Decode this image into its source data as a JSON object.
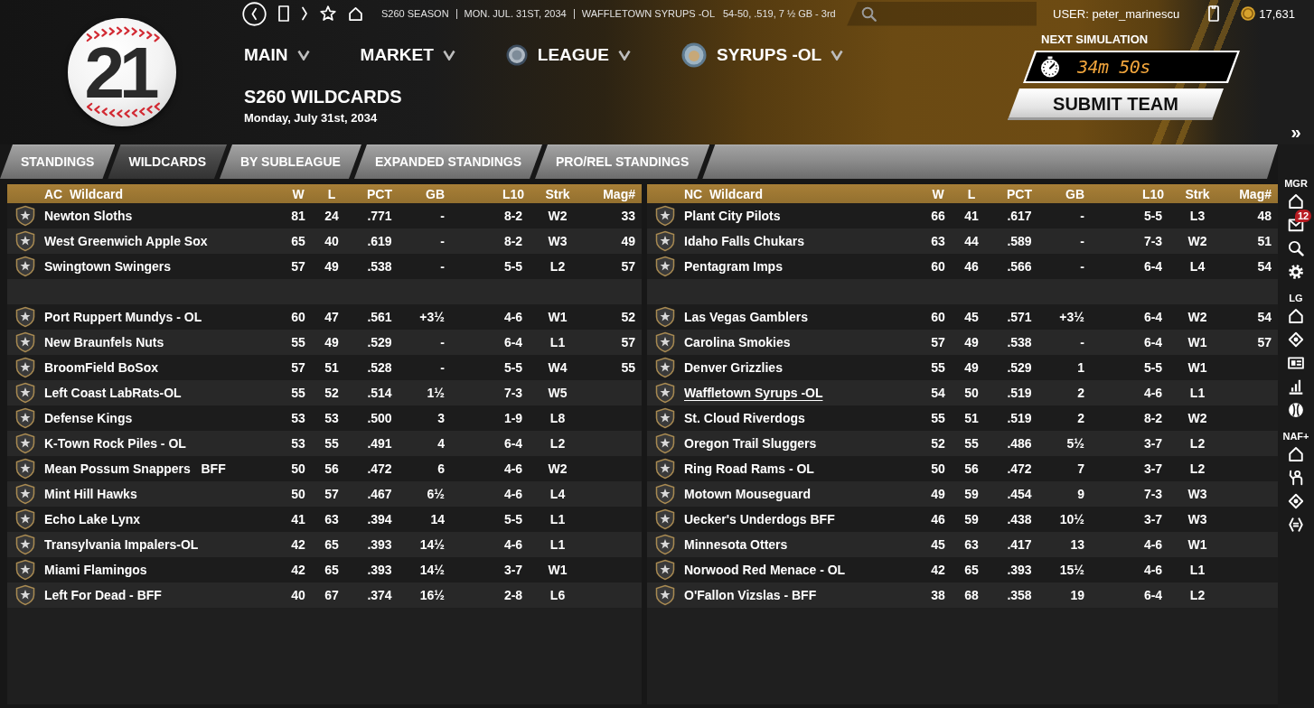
{
  "top_bar": {
    "season": "S260 SEASON",
    "date": "MON. JUL. 31ST, 2034",
    "team": "WAFFLETOWN SYRUPS -OL",
    "record": "54-50, .519, 7 ½ GB - 3rd",
    "user": "USER: peter_marinescu",
    "coins": "17,631"
  },
  "logo": {
    "text": "21"
  },
  "menu": [
    {
      "label": "MAIN",
      "kind": "plain"
    },
    {
      "label": "MARKET",
      "kind": "plain"
    },
    {
      "label": "LEAGUE",
      "kind": "league"
    },
    {
      "label": "SYRUPS -OL",
      "kind": "team"
    }
  ],
  "page": {
    "title": "S260 WILDCARDS",
    "subtitle": "Monday, July 31st, 2034"
  },
  "simulation": {
    "label": "NEXT SIMULATION",
    "countdown": "34m 50s",
    "button": "SUBMIT TEAM"
  },
  "expand": "»",
  "tabs": [
    {
      "label": "STANDINGS",
      "selected": false
    },
    {
      "label": "WILDCARDS",
      "selected": true
    },
    {
      "label": "BY SUBLEAGUE",
      "selected": false
    },
    {
      "label": "EXPANDED STANDINGS",
      "selected": false
    },
    {
      "label": "PRO/REL STANDINGS",
      "selected": false
    }
  ],
  "tables": [
    {
      "title": "AC  Wildcard",
      "columns": [
        "W",
        "L",
        "PCT",
        "GB",
        "L10",
        "Strk",
        "Mag#"
      ],
      "groups": [
        {
          "rows": [
            {
              "team": "Newton Sloths",
              "stats": [
                "81",
                "24",
                ".771",
                "-",
                "8-2",
                "W2",
                "33"
              ],
              "user_team": false
            },
            {
              "team": "West Greenwich Apple Sox",
              "stats": [
                "65",
                "40",
                ".619",
                "-",
                "8-2",
                "W3",
                "49"
              ],
              "user_team": false
            },
            {
              "team": "Swingtown Swingers",
              "stats": [
                "57",
                "49",
                ".538",
                "-",
                "5-5",
                "L2",
                "57"
              ],
              "user_team": false
            }
          ]
        },
        {
          "rows": [
            {
              "team": "Port Ruppert Mundys - OL",
              "stats": [
                "60",
                "47",
                ".561",
                "+3½",
                "4-6",
                "W1",
                "52"
              ],
              "user_team": false
            },
            {
              "team": "New Braunfels Nuts",
              "stats": [
                "55",
                "49",
                ".529",
                "-",
                "6-4",
                "L1",
                "57"
              ],
              "user_team": false
            },
            {
              "team": "BroomField BoSox",
              "stats": [
                "57",
                "51",
                ".528",
                "-",
                "5-5",
                "W4",
                "55"
              ],
              "user_team": false
            },
            {
              "team": "Left Coast LabRats-OL",
              "stats": [
                "55",
                "52",
                ".514",
                "1½",
                "7-3",
                "W5"
              ],
              "user_team": false
            },
            {
              "team": "Defense Kings",
              "stats": [
                "53",
                "53",
                ".500",
                "3",
                "1-9",
                "L8"
              ],
              "user_team": false
            },
            {
              "team": "K-Town Rock Piles - OL",
              "stats": [
                "53",
                "55",
                ".491",
                "4",
                "6-4",
                "L2"
              ],
              "user_team": false
            },
            {
              "team": "Mean Possum Snappers   BFF",
              "stats": [
                "50",
                "56",
                ".472",
                "6",
                "4-6",
                "W2"
              ],
              "user_team": false
            },
            {
              "team": "Mint Hill Hawks",
              "stats": [
                "50",
                "57",
                ".467",
                "6½",
                "4-6",
                "L4"
              ],
              "user_team": false
            },
            {
              "team": "Echo Lake Lynx",
              "stats": [
                "41",
                "63",
                ".394",
                "14",
                "5-5",
                "L1"
              ],
              "user_team": false
            },
            {
              "team": "Transylvania Impalers-OL",
              "stats": [
                "42",
                "65",
                ".393",
                "14½",
                "4-6",
                "L1"
              ],
              "user_team": false
            },
            {
              "team": "Miami Flamingos",
              "stats": [
                "42",
                "65",
                ".393",
                "14½",
                "3-7",
                "W1"
              ],
              "user_team": false
            },
            {
              "team": "Left For Dead - BFF",
              "stats": [
                "40",
                "67",
                ".374",
                "16½",
                "2-8",
                "L6"
              ],
              "user_team": false
            }
          ]
        }
      ]
    },
    {
      "title": "NC  Wildcard",
      "columns": [
        "W",
        "L",
        "PCT",
        "GB",
        "L10",
        "Strk",
        "Mag#"
      ],
      "groups": [
        {
          "rows": [
            {
              "team": "Plant City Pilots",
              "stats": [
                "66",
                "41",
                ".617",
                "-",
                "5-5",
                "L3",
                "48"
              ],
              "user_team": false
            },
            {
              "team": "Idaho Falls Chukars",
              "stats": [
                "63",
                "44",
                ".589",
                "-",
                "7-3",
                "W2",
                "51"
              ],
              "user_team": false
            },
            {
              "team": "Pentagram Imps",
              "stats": [
                "60",
                "46",
                ".566",
                "-",
                "6-4",
                "L4",
                "54"
              ],
              "user_team": false
            }
          ]
        },
        {
          "rows": [
            {
              "team": "Las Vegas Gamblers",
              "stats": [
                "60",
                "45",
                ".571",
                "+3½",
                "6-4",
                "W2",
                "54"
              ],
              "user_team": false
            },
            {
              "team": "Carolina Smokies",
              "stats": [
                "57",
                "49",
                ".538",
                "-",
                "6-4",
                "W1",
                "57"
              ],
              "user_team": false
            },
            {
              "team": "Denver Grizzlies",
              "stats": [
                "55",
                "49",
                ".529",
                "1",
                "5-5",
                "W1"
              ],
              "user_team": false
            },
            {
              "team": "Waffletown Syrups -OL",
              "stats": [
                "54",
                "50",
                ".519",
                "2",
                "4-6",
                "L1"
              ],
              "user_team": true
            },
            {
              "team": "St. Cloud Riverdogs",
              "stats": [
                "55",
                "51",
                ".519",
                "2",
                "8-2",
                "W2"
              ],
              "user_team": false
            },
            {
              "team": "Oregon Trail Sluggers",
              "stats": [
                "52",
                "55",
                ".486",
                "5½",
                "3-7",
                "L2"
              ],
              "user_team": false
            },
            {
              "team": "Ring Road Rams - OL",
              "stats": [
                "50",
                "56",
                ".472",
                "7",
                "3-7",
                "L2"
              ],
              "user_team": false
            },
            {
              "team": "Motown Mouseguard",
              "stats": [
                "49",
                "59",
                ".454",
                "9",
                "7-3",
                "W3"
              ],
              "user_team": false
            },
            {
              "team": "Uecker's Underdogs BFF",
              "stats": [
                "46",
                "59",
                ".438",
                "10½",
                "3-7",
                "W3"
              ],
              "user_team": false
            },
            {
              "team": "Minnesota Otters",
              "stats": [
                "45",
                "63",
                ".417",
                "13",
                "4-6",
                "W1"
              ],
              "user_team": false
            },
            {
              "team": "Norwood Red Menace - OL",
              "stats": [
                "42",
                "65",
                ".393",
                "15½",
                "4-6",
                "L1"
              ],
              "user_team": false
            },
            {
              "team": "O'Fallon Vizslas - BFF",
              "stats": [
                "38",
                "68",
                ".358",
                "19",
                "6-4",
                "L2"
              ],
              "user_team": false
            }
          ]
        }
      ]
    }
  ],
  "sidebar": {
    "sections": [
      {
        "label": "MGR",
        "items": [
          {
            "kind": "home"
          },
          {
            "kind": "mail",
            "badge": "12"
          },
          {
            "kind": "search"
          },
          {
            "kind": "settings"
          }
        ]
      },
      {
        "label": "LG",
        "items": [
          {
            "kind": "home"
          },
          {
            "kind": "field"
          },
          {
            "kind": "card"
          },
          {
            "kind": "chart"
          },
          {
            "kind": "ball"
          }
        ]
      },
      {
        "label": "NAF+",
        "items": [
          {
            "kind": "home"
          },
          {
            "kind": "person"
          },
          {
            "kind": "field"
          },
          {
            "kind": "code"
          }
        ]
      }
    ]
  }
}
